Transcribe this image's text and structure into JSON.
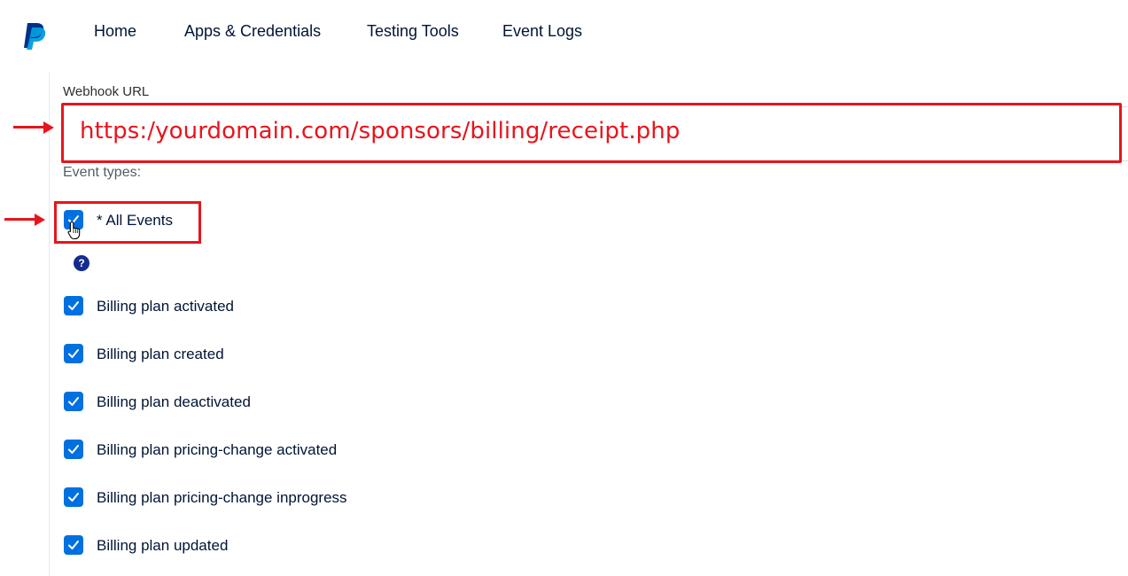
{
  "nav": {
    "logo": "paypal-logo",
    "items": [
      "Home",
      "Apps & Credentials",
      "Testing Tools",
      "Event Logs"
    ]
  },
  "webhook": {
    "label": "Webhook URL",
    "url": "https:/yourdomain.com/sponsors/billing/receipt.php"
  },
  "events": {
    "label": "Event types:",
    "all_events": {
      "label": "* All Events",
      "checked": true
    },
    "help_icon": "?",
    "items": [
      {
        "label": "Billing plan activated",
        "checked": true
      },
      {
        "label": "Billing plan created",
        "checked": true
      },
      {
        "label": "Billing plan deactivated",
        "checked": true
      },
      {
        "label": "Billing plan pricing-change activated",
        "checked": true
      },
      {
        "label": "Billing plan pricing-change inprogress",
        "checked": true
      },
      {
        "label": "Billing plan updated",
        "checked": true
      }
    ]
  },
  "colors": {
    "accent": "#0070e0",
    "annotation": "#e8141c",
    "text": "#001435",
    "paypal_dark": "#003087",
    "paypal_light": "#009cde"
  }
}
